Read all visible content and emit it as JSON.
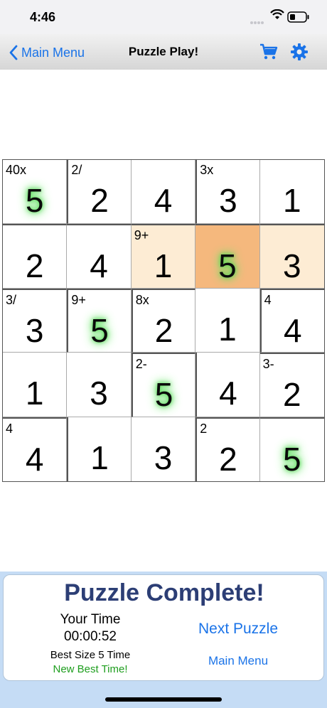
{
  "status": {
    "time": "4:46"
  },
  "nav": {
    "back_label": "Main Menu",
    "title": "Puzzle Play!"
  },
  "grid": {
    "size": 5,
    "cells": [
      [
        {
          "value": "5",
          "clue": "40x",
          "glow": true
        },
        {
          "value": "2",
          "clue": "2/"
        },
        {
          "value": "4",
          "clue": ""
        },
        {
          "value": "3",
          "clue": "3x"
        },
        {
          "value": "1",
          "clue": ""
        }
      ],
      [
        {
          "value": "2",
          "clue": ""
        },
        {
          "value": "4",
          "clue": ""
        },
        {
          "value": "1",
          "clue": "9+",
          "highlight": "light"
        },
        {
          "value": "5",
          "clue": "",
          "glow": true,
          "highlight": "strong"
        },
        {
          "value": "3",
          "clue": "",
          "highlight": "light"
        }
      ],
      [
        {
          "value": "3",
          "clue": "3/"
        },
        {
          "value": "5",
          "clue": "9+",
          "glow": true
        },
        {
          "value": "2",
          "clue": "8x"
        },
        {
          "value": "1",
          "clue": ""
        },
        {
          "value": "4",
          "clue": "4"
        }
      ],
      [
        {
          "value": "1",
          "clue": ""
        },
        {
          "value": "3",
          "clue": ""
        },
        {
          "value": "5",
          "clue": "2-",
          "glow": true
        },
        {
          "value": "4",
          "clue": ""
        },
        {
          "value": "2",
          "clue": "3-"
        }
      ],
      [
        {
          "value": "4",
          "clue": "4"
        },
        {
          "value": "1",
          "clue": ""
        },
        {
          "value": "3",
          "clue": ""
        },
        {
          "value": "2",
          "clue": "2"
        },
        {
          "value": "5",
          "clue": "",
          "glow": true
        }
      ]
    ]
  },
  "complete": {
    "title": "Puzzle Complete!",
    "your_time_label": "Your Time",
    "your_time": "00:00:52",
    "best_label": "Best Size 5 Time",
    "best_new": "New Best Time!",
    "next_button": "Next Puzzle",
    "menu_button": "Main Menu"
  },
  "colors": {
    "accent": "#1a73e8",
    "title": "#2c3e75",
    "highlight_light": "#fdecd4",
    "highlight_strong": "#f5b87d",
    "success": "#1e9e1e"
  }
}
